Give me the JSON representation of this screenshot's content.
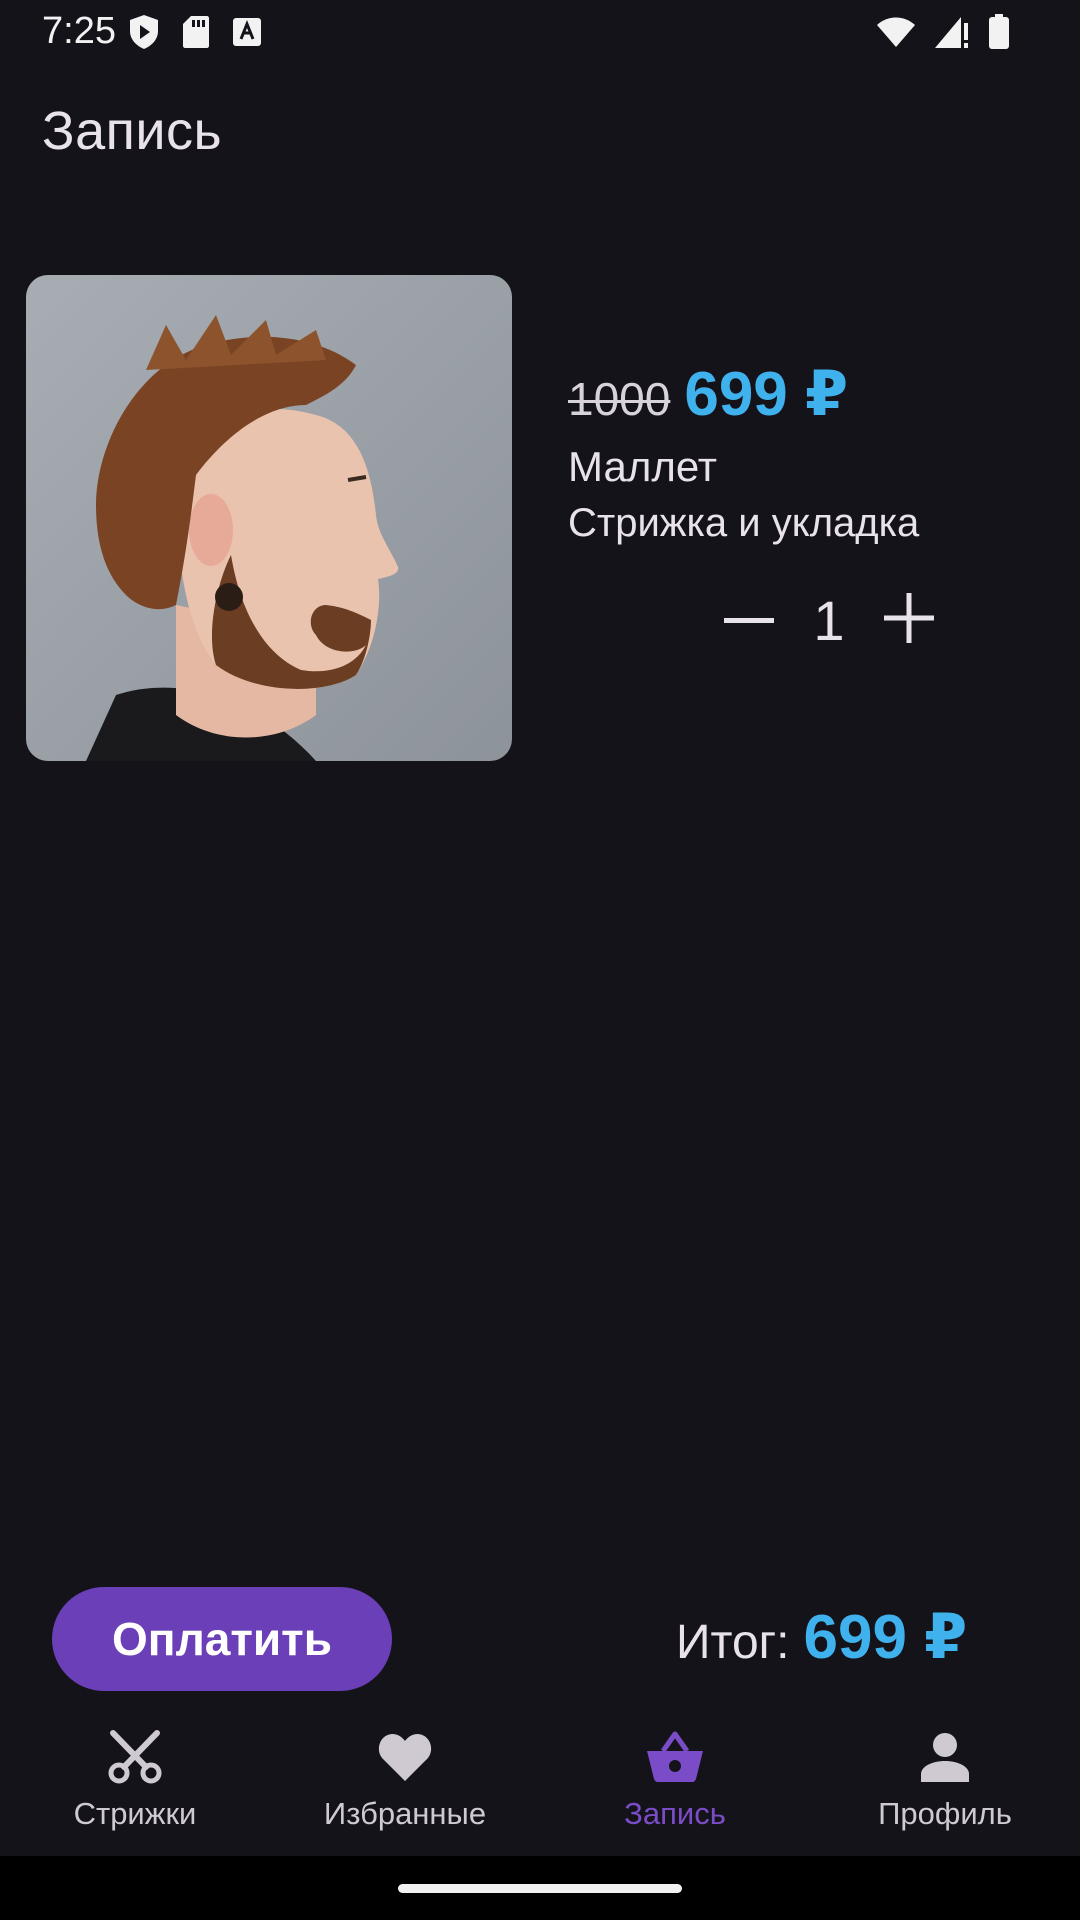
{
  "status_bar": {
    "time": "7:25",
    "left_icons": [
      "shield-play-icon",
      "sd-card-icon",
      "font-a-icon"
    ],
    "right_icons": [
      "wifi-icon",
      "signal-alert-icon",
      "battery-icon"
    ]
  },
  "page": {
    "title": "Запись"
  },
  "cart_item": {
    "image": "mullet-haircut-photo",
    "old_price": "1000",
    "new_price": "699 ₽",
    "name": "Маллет",
    "description": "Стрижка и укладка",
    "quantity": "1",
    "decrement_icon": "minus-icon",
    "increment_icon": "plus-icon"
  },
  "footer": {
    "pay_label": "Оплатить",
    "total_label": "Итог:",
    "total_value": "699 ₽"
  },
  "bottom_nav": {
    "items": [
      {
        "label": "Стрижки",
        "icon": "scissors-icon",
        "active": false
      },
      {
        "label": "Избранные",
        "icon": "heart-icon",
        "active": false
      },
      {
        "label": "Запись",
        "icon": "basket-icon",
        "active": true
      },
      {
        "label": "Профиль",
        "icon": "person-icon",
        "active": false
      }
    ]
  },
  "colors": {
    "background": "#15131a",
    "accent_price": "#3fb2ee",
    "primary_button": "#6a3fb8",
    "active_nav": "#7a4cc7"
  }
}
